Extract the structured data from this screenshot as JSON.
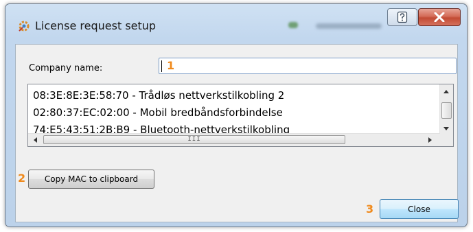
{
  "window": {
    "title": "License request setup",
    "icons": {
      "app": "license-gear-icon",
      "help": "help-icon",
      "close": "close-icon"
    }
  },
  "form": {
    "company_label": "Company name:",
    "company_value": ""
  },
  "mac_list": {
    "items": [
      "08:3E:8E:3E:58:70 - Trådløs nettverkstilkobling 2",
      "02:80:37:EC:02:00 - Mobil bredbåndsforbindelse",
      "74:E5:43:51:2B:B9 - Bluetooth-nettverkstilkobling"
    ],
    "scrollbar_grip": "III"
  },
  "buttons": {
    "copy_mac": "Copy MAC to clipboard",
    "close": "Close"
  },
  "annotations": {
    "marker_1": "1",
    "marker_2": "2",
    "marker_3": "3"
  },
  "colors": {
    "annotation": "#f08a1c",
    "close_button": "#c24b34"
  }
}
